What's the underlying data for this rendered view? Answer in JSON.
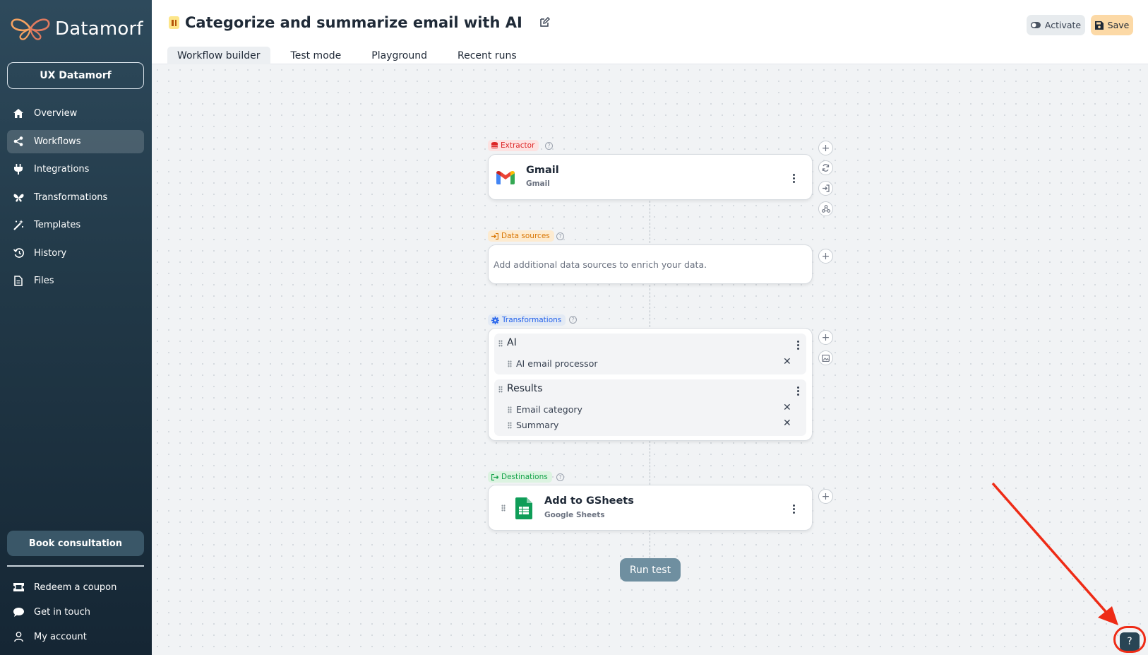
{
  "app": {
    "logo_text": "Datamorf",
    "workspace": "UX Datamorf"
  },
  "sidebar": {
    "items": [
      {
        "label": "Overview",
        "icon": "home-icon",
        "active": false
      },
      {
        "label": "Workflows",
        "icon": "share-icon",
        "active": true
      },
      {
        "label": "Integrations",
        "icon": "plug-icon",
        "active": false
      },
      {
        "label": "Transformations",
        "icon": "butterfly-icon",
        "active": false
      },
      {
        "label": "Templates",
        "icon": "magic-wand-icon",
        "active": false
      },
      {
        "label": "History",
        "icon": "history-icon",
        "active": false
      },
      {
        "label": "Files",
        "icon": "file-icon",
        "active": false
      }
    ],
    "book_consultation": "Book consultation",
    "bottom_items": [
      {
        "label": "Redeem a coupon",
        "icon": "ticket-icon"
      },
      {
        "label": "Get in touch",
        "icon": "chat-icon"
      },
      {
        "label": "My account",
        "icon": "user-icon"
      }
    ]
  },
  "header": {
    "title": "Categorize and summarize email with AI",
    "status": "paused",
    "tabs": [
      "Workflow builder",
      "Test mode",
      "Playground",
      "Recent runs"
    ],
    "active_tab": "Workflow builder",
    "activate_label": "Activate",
    "save_label": "Save"
  },
  "workflow": {
    "extractor": {
      "label": "Extractor",
      "name": "Gmail",
      "sub": "Gmail"
    },
    "data_sources": {
      "label": "Data sources",
      "placeholder": "Add additional data sources to enrich your data."
    },
    "transformations": {
      "label": "Transformations",
      "groups": [
        {
          "name": "AI",
          "items": [
            "AI email processor"
          ]
        },
        {
          "name": "Results",
          "items": [
            "Email category",
            "Summary"
          ]
        }
      ]
    },
    "destinations": {
      "label": "Destinations",
      "name": "Add to GSheets",
      "sub": "Google Sheets"
    },
    "run_test": "Run test"
  },
  "help_button": "?",
  "colors": {
    "accent": "#fcd9a6",
    "extractor": "#ef4444",
    "data_sources": "#d97706",
    "transformations": "#2563eb",
    "destinations": "#16a34a",
    "annotation": "#ee2b16"
  }
}
